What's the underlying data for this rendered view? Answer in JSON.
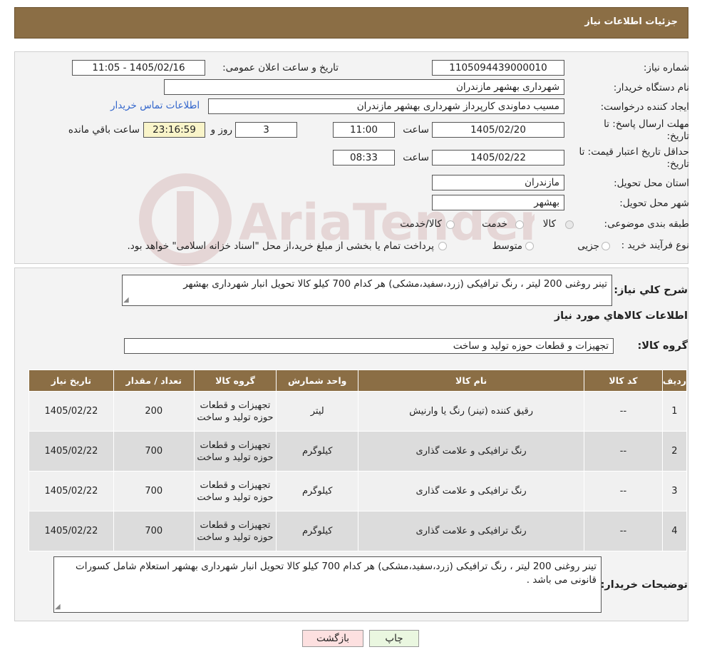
{
  "header": {
    "title": "جزئیات اطلاعات نیاز"
  },
  "form": {
    "need_number_label": "شماره نیاز:",
    "need_number": "1105094439000010",
    "announce_label": "تاریخ و ساعت اعلان عمومی:",
    "announce_value": "1405/02/16 - 11:05",
    "buyer_org_label": "نام دستگاه خریدار:",
    "buyer_org": "شهرداری بهشهر مازندران",
    "creator_label": "ایجاد کننده درخواست:",
    "creator": "مسیب دماوندی کارپرداز شهرداری بهشهر مازندران",
    "contact_link": "اطلاعات تماس خریدار",
    "deadline_label": "مهلت ارسال پاسخ: تا تاریخ:",
    "deadline_date": "1405/02/20",
    "time_label": "ساعت",
    "deadline_time": "11:00",
    "days_value": "3",
    "days_label": "روز و",
    "remaining_time": "23:16:59",
    "remaining_label": "ساعت باقي مانده",
    "validity_label": "حداقل تاریخ اعتبار قیمت: تا تاریخ:",
    "validity_date": "1405/02/22",
    "validity_time": "08:33",
    "province_label": "استان محل تحویل:",
    "province": "مازندران",
    "city_label": "شهر محل تحویل:",
    "city": "بهشهر",
    "category_label": "طبقه بندی موضوعی:",
    "category_options": [
      "کالا",
      "خدمت",
      "کالا/خدمت"
    ],
    "category_selected": "کالا",
    "process_label": "نوع فرآیند خرید :",
    "process_options": [
      "جزیی",
      "متوسط"
    ],
    "process_note": "پرداخت تمام یا بخشی از مبلغ خرید،از محل \"اسناد خزانه اسلامی\" خواهد بود."
  },
  "summary": {
    "label": "شرح کلي نياز:",
    "text": "تینر روغنی 200 لیتر ، رنگ ترافیکی (زرد،سفید،مشکی) هر کدام 700 کیلو کالا تحویل انبار شهرداری بهشهر",
    "goods_info_title": "اطلاعات کالاهاي مورد نياز",
    "goods_group_label": "گروه کالا:",
    "goods_group": "تجهیزات و قطعات حوزه تولید و ساخت"
  },
  "table": {
    "headers": [
      "ردیف",
      "کد کالا",
      "نام کالا",
      "واحد شمارش",
      "گروه کالا",
      "تعداد / مقدار",
      "تاریخ نیاز"
    ],
    "rows": [
      {
        "idx": "1",
        "code": "--",
        "name": "رقیق کننده (تینر) رنگ یا وارنیش",
        "unit": "لیتر",
        "group": "تجهیزات و قطعات حوزه تولید و ساخت",
        "qty": "200",
        "date": "1405/02/22"
      },
      {
        "idx": "2",
        "code": "--",
        "name": "رنگ ترافیکی و علامت گذاری",
        "unit": "کیلوگرم",
        "group": "تجهیزات و قطعات حوزه تولید و ساخت",
        "qty": "700",
        "date": "1405/02/22"
      },
      {
        "idx": "3",
        "code": "--",
        "name": "رنگ ترافیکی و علامت گذاری",
        "unit": "کیلوگرم",
        "group": "تجهیزات و قطعات حوزه تولید و ساخت",
        "qty": "700",
        "date": "1405/02/22"
      },
      {
        "idx": "4",
        "code": "--",
        "name": "رنگ ترافیکی و علامت گذاری",
        "unit": "کیلوگرم",
        "group": "تجهیزات و قطعات حوزه تولید و ساخت",
        "qty": "700",
        "date": "1405/02/22"
      }
    ]
  },
  "notes": {
    "label": "توضیحات خریدار:",
    "text": "تینر روغنی 200 لیتر ، رنگ ترافیکی (زرد،سفید،مشکی) هر کدام 700 کیلو کالا تحویل انبار شهرداری بهشهر  استعلام شامل کسورات قانونی می باشد ."
  },
  "buttons": {
    "print": "چاپ",
    "back": "بازگشت"
  },
  "watermark": {
    "text": "AriaTender.neT"
  },
  "colors": {
    "header_bg": "#8b6e45",
    "link": "#3366cc",
    "back_button": "#fde0e0",
    "print_button": "#eaf7e0",
    "remaining_bg": "#f9f4c9"
  }
}
